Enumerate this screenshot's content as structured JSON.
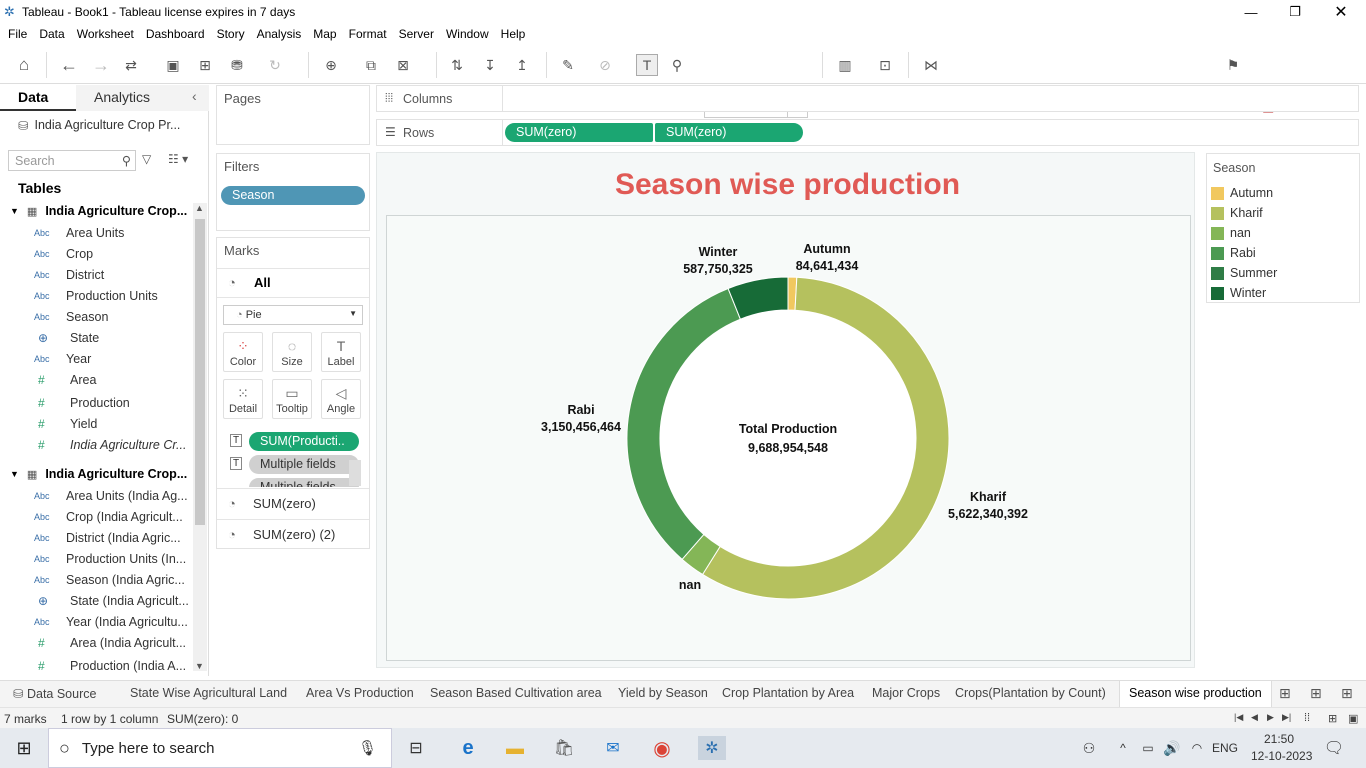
{
  "window": {
    "title": "Tableau - Book1 - Tableau license expires in 7 days"
  },
  "menu": [
    "File",
    "Data",
    "Worksheet",
    "Dashboard",
    "Story",
    "Analysis",
    "Map",
    "Format",
    "Server",
    "Window",
    "Help"
  ],
  "toolbar": {
    "fit_value": "Fit Width",
    "show_me": "Show Me"
  },
  "left_pane": {
    "tabs": [
      "Data",
      "Analytics"
    ],
    "datasource": "India Agriculture Crop Pr...",
    "search_placeholder": "Search",
    "tables_heading": "Tables",
    "table1": {
      "name": "India Agriculture Crop...",
      "fields": [
        {
          "type": "Abc",
          "name": "Area Units"
        },
        {
          "type": "Abc",
          "name": "Crop"
        },
        {
          "type": "Abc",
          "name": "District"
        },
        {
          "type": "Abc",
          "name": "Production Units"
        },
        {
          "type": "Abc",
          "name": "Season"
        },
        {
          "type": "globe",
          "name": "State"
        },
        {
          "type": "Abc",
          "name": "Year"
        },
        {
          "type": "#",
          "name": "Area"
        },
        {
          "type": "#",
          "name": "Production"
        },
        {
          "type": "#",
          "name": "Yield"
        },
        {
          "type": "#",
          "name": "India Agriculture Cr..."
        }
      ]
    },
    "table2": {
      "name": "India Agriculture Crop...",
      "fields": [
        {
          "type": "Abc",
          "name": "Area Units (India Ag..."
        },
        {
          "type": "Abc",
          "name": "Crop (India Agricult..."
        },
        {
          "type": "Abc",
          "name": "District (India Agric..."
        },
        {
          "type": "Abc",
          "name": "Production Units (In..."
        },
        {
          "type": "Abc",
          "name": "Season (India Agric..."
        },
        {
          "type": "globe",
          "name": "State (India Agricult..."
        },
        {
          "type": "Abc",
          "name": "Year (India Agricultu..."
        },
        {
          "type": "#",
          "name": "Area (India Agricult..."
        },
        {
          "type": "#",
          "name": "Production (India A..."
        }
      ]
    }
  },
  "shelves": {
    "pages": "Pages",
    "filters": "Filters",
    "filter_pill": "Season",
    "columns": "Columns",
    "rows": "Rows",
    "row_pills": [
      "SUM(zero)",
      "SUM(zero)"
    ]
  },
  "marks": {
    "title": "Marks",
    "all": "All",
    "mark_type": "Pie",
    "buttons": [
      "Color",
      "Size",
      "Label",
      "Detail",
      "Tooltip",
      "Angle"
    ],
    "pills": [
      "SUM(Producti..",
      "Multiple fields",
      "Multiple fields"
    ],
    "sections": [
      "SUM(zero)",
      "SUM(zero) (2)"
    ]
  },
  "view": {
    "title": "Season wise production",
    "center_label": "Total Production",
    "center_value": "9,688,954,548"
  },
  "chart_data": {
    "type": "pie",
    "title": "Season wise production",
    "categories": [
      "Autumn",
      "Kharif",
      "nan",
      "Rabi",
      "Summer",
      "Winter"
    ],
    "values": [
      84641434,
      5622340392,
      243776000,
      3150456464,
      0,
      587750325
    ],
    "labels": {
      "Autumn": "84,641,434",
      "Kharif": "5,622,340,392",
      "Rabi": "3,150,456,464",
      "Winter": "587,750,325"
    },
    "colors": [
      "#f1c85f",
      "#b5c15e",
      "#84b657",
      "#4c9a52",
      "#2f7d46",
      "#176b37"
    ],
    "total_label": "Total Production",
    "total_value": "9,688,954,548"
  },
  "legend": {
    "title": "Season",
    "items": [
      {
        "name": "Autumn",
        "color": "#f1c85f"
      },
      {
        "name": "Kharif",
        "color": "#b5c15e"
      },
      {
        "name": "nan",
        "color": "#84b657"
      },
      {
        "name": "Rabi",
        "color": "#4c9a52"
      },
      {
        "name": "Summer",
        "color": "#2f7d46"
      },
      {
        "name": "Winter",
        "color": "#176b37"
      }
    ]
  },
  "sheet_tabs": [
    "Data Source",
    "State Wise Agricultural Land",
    "Area Vs Production",
    "Season Based Cultivation area",
    "Yield by Season",
    "Crop Plantation by Area",
    "Major Crops",
    "Crops(Plantation by Count)",
    "Season wise production"
  ],
  "status": {
    "marks": "7 marks",
    "rows": "1 row by 1 column",
    "sum": "SUM(zero): 0"
  },
  "taskbar": {
    "search_placeholder": "Type here to search",
    "lang": "ENG",
    "time": "21:50",
    "date": "12-10-2023"
  }
}
